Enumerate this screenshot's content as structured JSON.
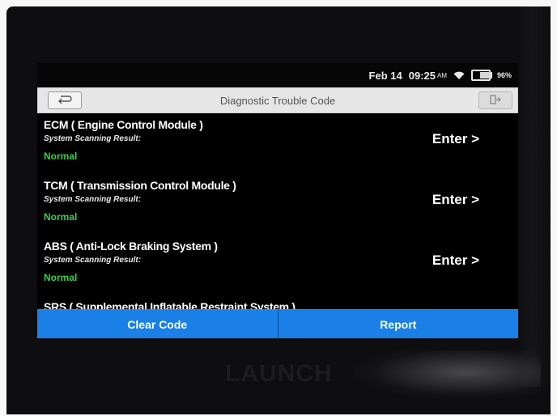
{
  "statusbar": {
    "date": "Feb 14",
    "time": "09:25",
    "ampm": "AM",
    "battery": "96%"
  },
  "header": {
    "title": "Diagnostic Trouble Code"
  },
  "modules": [
    {
      "name": "ECM ( Engine Control Module )",
      "subtitle": "System Scanning Result:",
      "status": "Normal",
      "action": "Enter >"
    },
    {
      "name": "TCM ( Transmission Control Module )",
      "subtitle": "System Scanning Result:",
      "status": "Normal",
      "action": "Enter >"
    },
    {
      "name": "ABS ( Anti-Lock Braking System )",
      "subtitle": "System Scanning Result:",
      "status": "Normal",
      "action": "Enter >"
    },
    {
      "name": "SRS ( Supplemental Inflatable Restraint System )"
    }
  ],
  "footer": {
    "clear_label": "Clear Code",
    "report_label": "Report"
  },
  "device": {
    "brand": "LAUNCH"
  },
  "colors": {
    "accent": "#1a7fe6",
    "status_ok": "#35d04a"
  }
}
